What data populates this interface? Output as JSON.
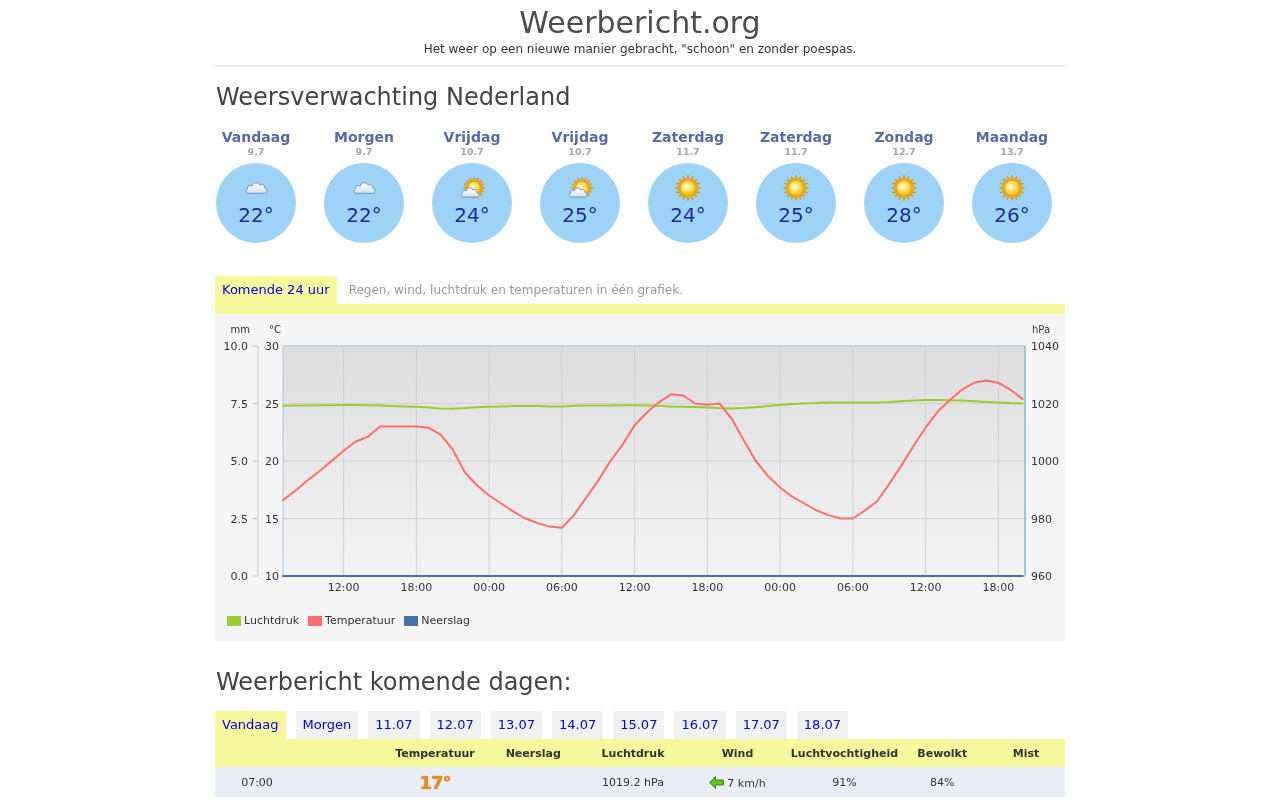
{
  "header": {
    "title": "Weerbericht.org",
    "tagline": "Het weer op een nieuwe manier gebracht, \"schoon\" en zonder poespas."
  },
  "forecast": {
    "heading": "Weersverwachting Nederland",
    "days": [
      {
        "day": "Vandaag",
        "date": "9.7",
        "kind": "cloud",
        "temperature": "22°"
      },
      {
        "day": "Morgen",
        "date": "9.7",
        "kind": "cloud",
        "temperature": "22°"
      },
      {
        "day": "Vrijdag",
        "date": "10.7",
        "kind": "sun-cloud",
        "temperature": "24°"
      },
      {
        "day": "Vrijdag",
        "date": "10.7",
        "kind": "sun-cloud",
        "temperature": "25°"
      },
      {
        "day": "Zaterdag",
        "date": "11.7",
        "kind": "sun",
        "temperature": "24°"
      },
      {
        "day": "Zaterdag",
        "date": "11.7",
        "kind": "sun",
        "temperature": "25°"
      },
      {
        "day": "Zondag",
        "date": "12.7",
        "kind": "sun",
        "temperature": "28°"
      },
      {
        "day": "Maandag",
        "date": "13.7",
        "kind": "sun",
        "temperature": "26°"
      }
    ]
  },
  "chart_section": {
    "tabs": [
      {
        "label": "Komende 24 uur",
        "selected": true
      }
    ],
    "description": "Regen, wind, luchtdruk en temperaturen in één grafiek.",
    "chart_data": {
      "type": "line",
      "categories": [
        null,
        null,
        null,
        null,
        null,
        "12:00",
        null,
        null,
        null,
        null,
        null,
        "18:00",
        null,
        null,
        null,
        null,
        null,
        "00:00",
        null,
        null,
        null,
        null,
        null,
        "06:00",
        null,
        null,
        null,
        null,
        null,
        "12:00",
        null,
        null,
        null,
        null,
        null,
        "18:00",
        null,
        null,
        null,
        null,
        null,
        "00:00",
        null,
        null,
        null,
        null,
        null,
        "06:00",
        null,
        null,
        null,
        null,
        null,
        "12:00",
        null,
        null,
        null,
        null,
        null,
        "18:00",
        null,
        null
      ],
      "ylabel": "°C",
      "ylim": [
        10,
        30
      ],
      "yticks": [
        10,
        15,
        20,
        25,
        30
      ],
      "y2label": "hPa",
      "y2lim": [
        960,
        1040
      ],
      "y2ticks": [
        960,
        980,
        1000,
        1020,
        1040
      ],
      "y3label": "mm",
      "y3lim": [
        0,
        10
      ],
      "y3ticks": [
        {
          "value": 0,
          "label": "0.0"
        },
        {
          "value": 2.5,
          "label": "2.5"
        },
        {
          "value": 5,
          "label": "5.0"
        },
        {
          "value": 7.5,
          "label": "7.5"
        },
        {
          "value": 10,
          "label": "10.0"
        }
      ],
      "grid": true,
      "legend": "bottom-left",
      "series": [
        {
          "name": "Luchtdruk",
          "color": "#9acd32",
          "axis": "y2",
          "values": [
            1019.2,
            1019.3,
            1019.3,
            1019.4,
            1019.4,
            1019.5,
            1019.5,
            1019.4,
            1019.3,
            1019.1,
            1019.0,
            1018.9,
            1018.6,
            1018.3,
            1018.2,
            1018.4,
            1018.7,
            1018.9,
            1019.0,
            1019.1,
            1019.1,
            1019.1,
            1019.0,
            1019.0,
            1019.2,
            1019.3,
            1019.3,
            1019.3,
            1019.4,
            1019.4,
            1019.3,
            1019.2,
            1019.0,
            1018.9,
            1018.8,
            1018.6,
            1018.4,
            1018.3,
            1018.4,
            1018.7,
            1019.1,
            1019.5,
            1019.8,
            1020.0,
            1020.2,
            1020.3,
            1020.3,
            1020.3,
            1020.4,
            1020.4,
            1020.5,
            1020.8,
            1021.0,
            1021.2,
            1021.2,
            1021.1,
            1021.0,
            1020.8,
            1020.5,
            1020.3,
            1020.1,
            1020.0
          ]
        },
        {
          "name": "Temperatuur",
          "color": "#ff6e6e",
          "values": [
            16.6,
            17.4,
            18.3,
            19.1,
            20.0,
            20.9,
            21.7,
            22.1,
            23.0,
            23.0,
            23.0,
            23.0,
            22.9,
            22.3,
            21.0,
            19.0,
            17.9,
            17.0,
            16.3,
            15.6,
            15.0,
            14.6,
            14.3,
            14.2,
            15.3,
            16.8,
            18.3,
            20.0,
            21.4,
            23.1,
            24.2,
            25.1,
            25.8,
            25.7,
            25.0,
            24.9,
            25.0,
            23.7,
            21.8,
            20.0,
            18.7,
            17.7,
            16.9,
            16.3,
            15.7,
            15.3,
            15.0,
            15.0,
            15.7,
            16.5,
            18.0,
            19.6,
            21.3,
            22.9,
            24.3,
            25.3,
            26.2,
            26.8,
            27.0,
            26.8,
            26.2,
            25.4
          ]
        },
        {
          "name": "Neerslag",
          "color": "#4572a7",
          "axis": "y3",
          "values": [
            0,
            0,
            0,
            0,
            0,
            0,
            0,
            0,
            0,
            0,
            0,
            0,
            0,
            0,
            0,
            0,
            0,
            0,
            0,
            0,
            0,
            0,
            0,
            0,
            0,
            0,
            0,
            0,
            0,
            0,
            0,
            0,
            0,
            0,
            0,
            0,
            0,
            0,
            0,
            0,
            0,
            0,
            0,
            0,
            0,
            0,
            0,
            0,
            0,
            0,
            0,
            0,
            0,
            0,
            0,
            0,
            0,
            0,
            0,
            0,
            0,
            0
          ]
        }
      ]
    }
  },
  "details": {
    "heading": "Weerbericht komende dagen:",
    "tabs": [
      {
        "label": "Vandaag",
        "selected": true
      },
      {
        "label": "Morgen",
        "selected": false
      },
      {
        "label": "11.07",
        "selected": false
      },
      {
        "label": "12.07",
        "selected": false
      },
      {
        "label": "13.07",
        "selected": false
      },
      {
        "label": "14.07",
        "selected": false
      },
      {
        "label": "15.07",
        "selected": false
      },
      {
        "label": "16.07",
        "selected": false
      },
      {
        "label": "17.07",
        "selected": false
      },
      {
        "label": "18.07",
        "selected": false
      }
    ],
    "table": {
      "columns": [
        "Temperatuur",
        "Neerslag",
        "Luchtdruk",
        "Wind",
        "Luchtvochtigheid",
        "Bewolkt",
        "Mist"
      ],
      "rows": [
        {
          "time": "07:00",
          "temperature": "17°",
          "pressure": "1019.2 hPa",
          "wind": "7 km/h",
          "humidity": "91%",
          "cloud_cover": "84%"
        }
      ]
    }
  }
}
